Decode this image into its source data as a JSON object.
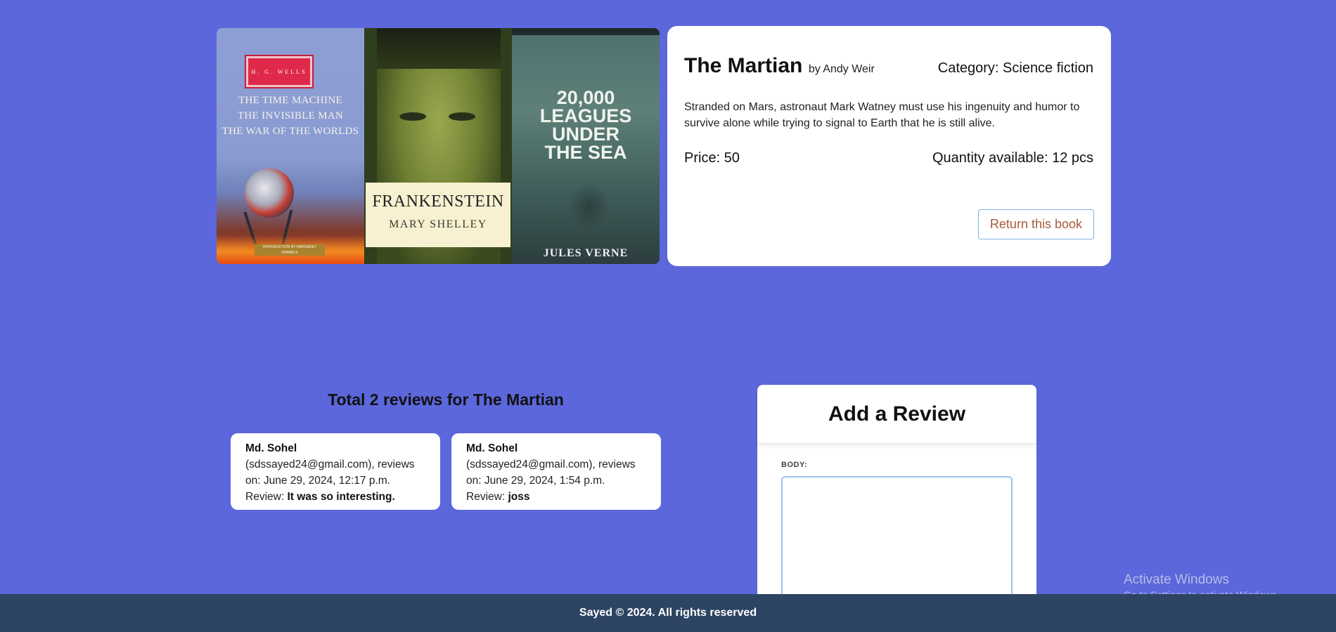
{
  "covers": [
    {
      "author_plate": "H. G. WELLS",
      "lines": [
        "THE TIME MACHINE",
        "THE INVISIBLE MAN",
        "THE WAR OF THE WORLDS"
      ],
      "intro": "INTRODUCTION BY MARGARET DRABBLE"
    },
    {
      "title": "FRANKENSTEIN",
      "author": "MARY SHELLEY"
    },
    {
      "title_lines": [
        "20,000",
        "LEAGUES",
        "UNDER",
        "THE SEA"
      ],
      "author": "JULES VERNE"
    }
  ],
  "book": {
    "title": "The Martian",
    "by": "by Andy Weir",
    "category": "Category: Science fiction",
    "description": "Stranded on Mars, astronaut Mark Watney must use his ingenuity and humor to survive alone while trying to signal to Earth that he is still alive.",
    "price": "Price: 50",
    "quantity": "Quantity available: 12 pcs",
    "return_button": "Return this book"
  },
  "reviews": {
    "title": "Total 2 reviews for The Martian",
    "items": [
      {
        "name": "Md. Sohel",
        "meta": "(sdssayed24@gmail.com), reviews on: June 29, 2024, 12:17 p.m.",
        "review_label": "Review: ",
        "text": "It was so interesting."
      },
      {
        "name": "Md. Sohel",
        "meta": "(sdssayed24@gmail.com), reviews on: June 29, 2024, 1:54 p.m.",
        "review_label": "Review: ",
        "text": "joss"
      }
    ]
  },
  "add_review": {
    "title": "Add a Review",
    "body_label": "BODY:",
    "body_value": ""
  },
  "watermark": {
    "line1": "Activate Windows",
    "line2": "Go to Settings to activate Windows."
  },
  "footer": {
    "text": "Sayed © 2024. All rights reserved"
  }
}
